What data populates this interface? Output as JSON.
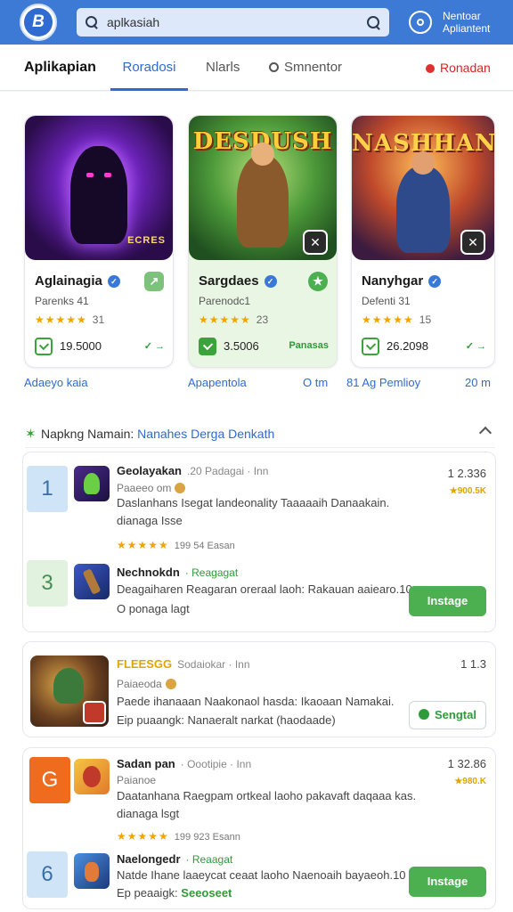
{
  "header": {
    "logo_text": "B",
    "search": {
      "value": "aplkasiah"
    },
    "right_text_line1": "Nentoar",
    "right_text_line2": "Apliantent"
  },
  "tabs": {
    "home": "Aplikapian",
    "rekomendasi": "Roradosi",
    "populer": "Nlarls",
    "semua": "Smnentor",
    "red": "Ronadan"
  },
  "featured": [
    {
      "art_title": "",
      "art_sub": "ECRES",
      "name": "Aglainagia",
      "dev": "Parenks 41",
      "rating": "31",
      "downloads": "19.5000",
      "badge": "✓ →",
      "stars": "★★★★★"
    },
    {
      "art_title": "DESDUSH",
      "art_sub": "",
      "name": "Sargdaes",
      "dev": "Parenodc1",
      "rating": "23",
      "downloads": "3.5006",
      "badge": "Panasas",
      "stars": "★★★★★"
    },
    {
      "art_title": "NASHHAN",
      "art_sub": "",
      "name": "Nanyhgar",
      "dev": "Defenti 31",
      "rating": "15",
      "downloads": "26.2098",
      "badge": "✓ →",
      "stars": "★★★★★"
    }
  ],
  "featured_links": {
    "link1": "Adaeyo kaia",
    "link2": "Apapentola",
    "link3": "O tm",
    "link4": "81 Ag Pemlioy",
    "link5": "20 m"
  },
  "section": {
    "title": "Napkng Namain:",
    "link": "Nanahes Derga Denkath"
  },
  "list": {
    "r1": {
      "rank": "1",
      "title": "Geolayakan",
      "meta": ".20 Padagai · Inn",
      "sub": "Paaeeo om",
      "desc1": "Daslanhans Isegat landeonality Taaaaaih Danaakain.",
      "desc2": "dianaga Isse",
      "stars": "★★★★★",
      "stars_num": "199 54 Easan",
      "count": "1 2.336",
      "badge": "★900.5K"
    },
    "r2": {
      "rank": "3",
      "title": "Nechnokdn",
      "meta": "· Reagagat",
      "desc1": "Deagaiharen Reagaran oreraal laoh: Rakauan aaiearo.10",
      "desc2": "O ponaga lagt",
      "button": "Instage"
    },
    "r3": {
      "title": "FLEESGG",
      "meta": "Sodaiokar · Inn",
      "sub": "Paiaeoda",
      "desc1": "Paede ihanaaan Naakonaol hasda: Ikaoaan Namakai.",
      "desc2": "Eip puaangk: Nanaeralt narkat (haodaade)",
      "count": "1 1.3",
      "button": "Sengtal"
    },
    "r4": {
      "rank": "G",
      "title": "Sadan pan",
      "meta": "· Oootipie · Inn",
      "sub": "Paianoe",
      "desc1": "Daatanhana Raegpam ortkeal laoho pakavaft daqaaa kas.",
      "desc2": "dianaga lsgt",
      "stars": "★★★★★",
      "stars_num": "199 923 Esann",
      "count": "1 32.86",
      "badge": "★980.K"
    },
    "r5": {
      "rank": "6",
      "title": "Naelongedr",
      "meta": "· Reaagat",
      "desc1": "Natde Ihane laaeycat ceaat laoho Naenoaih bayaeoh.10",
      "desc2": "Ep peaaigk:",
      "desc2_green": "Seeoseet",
      "button": "Instage"
    }
  }
}
